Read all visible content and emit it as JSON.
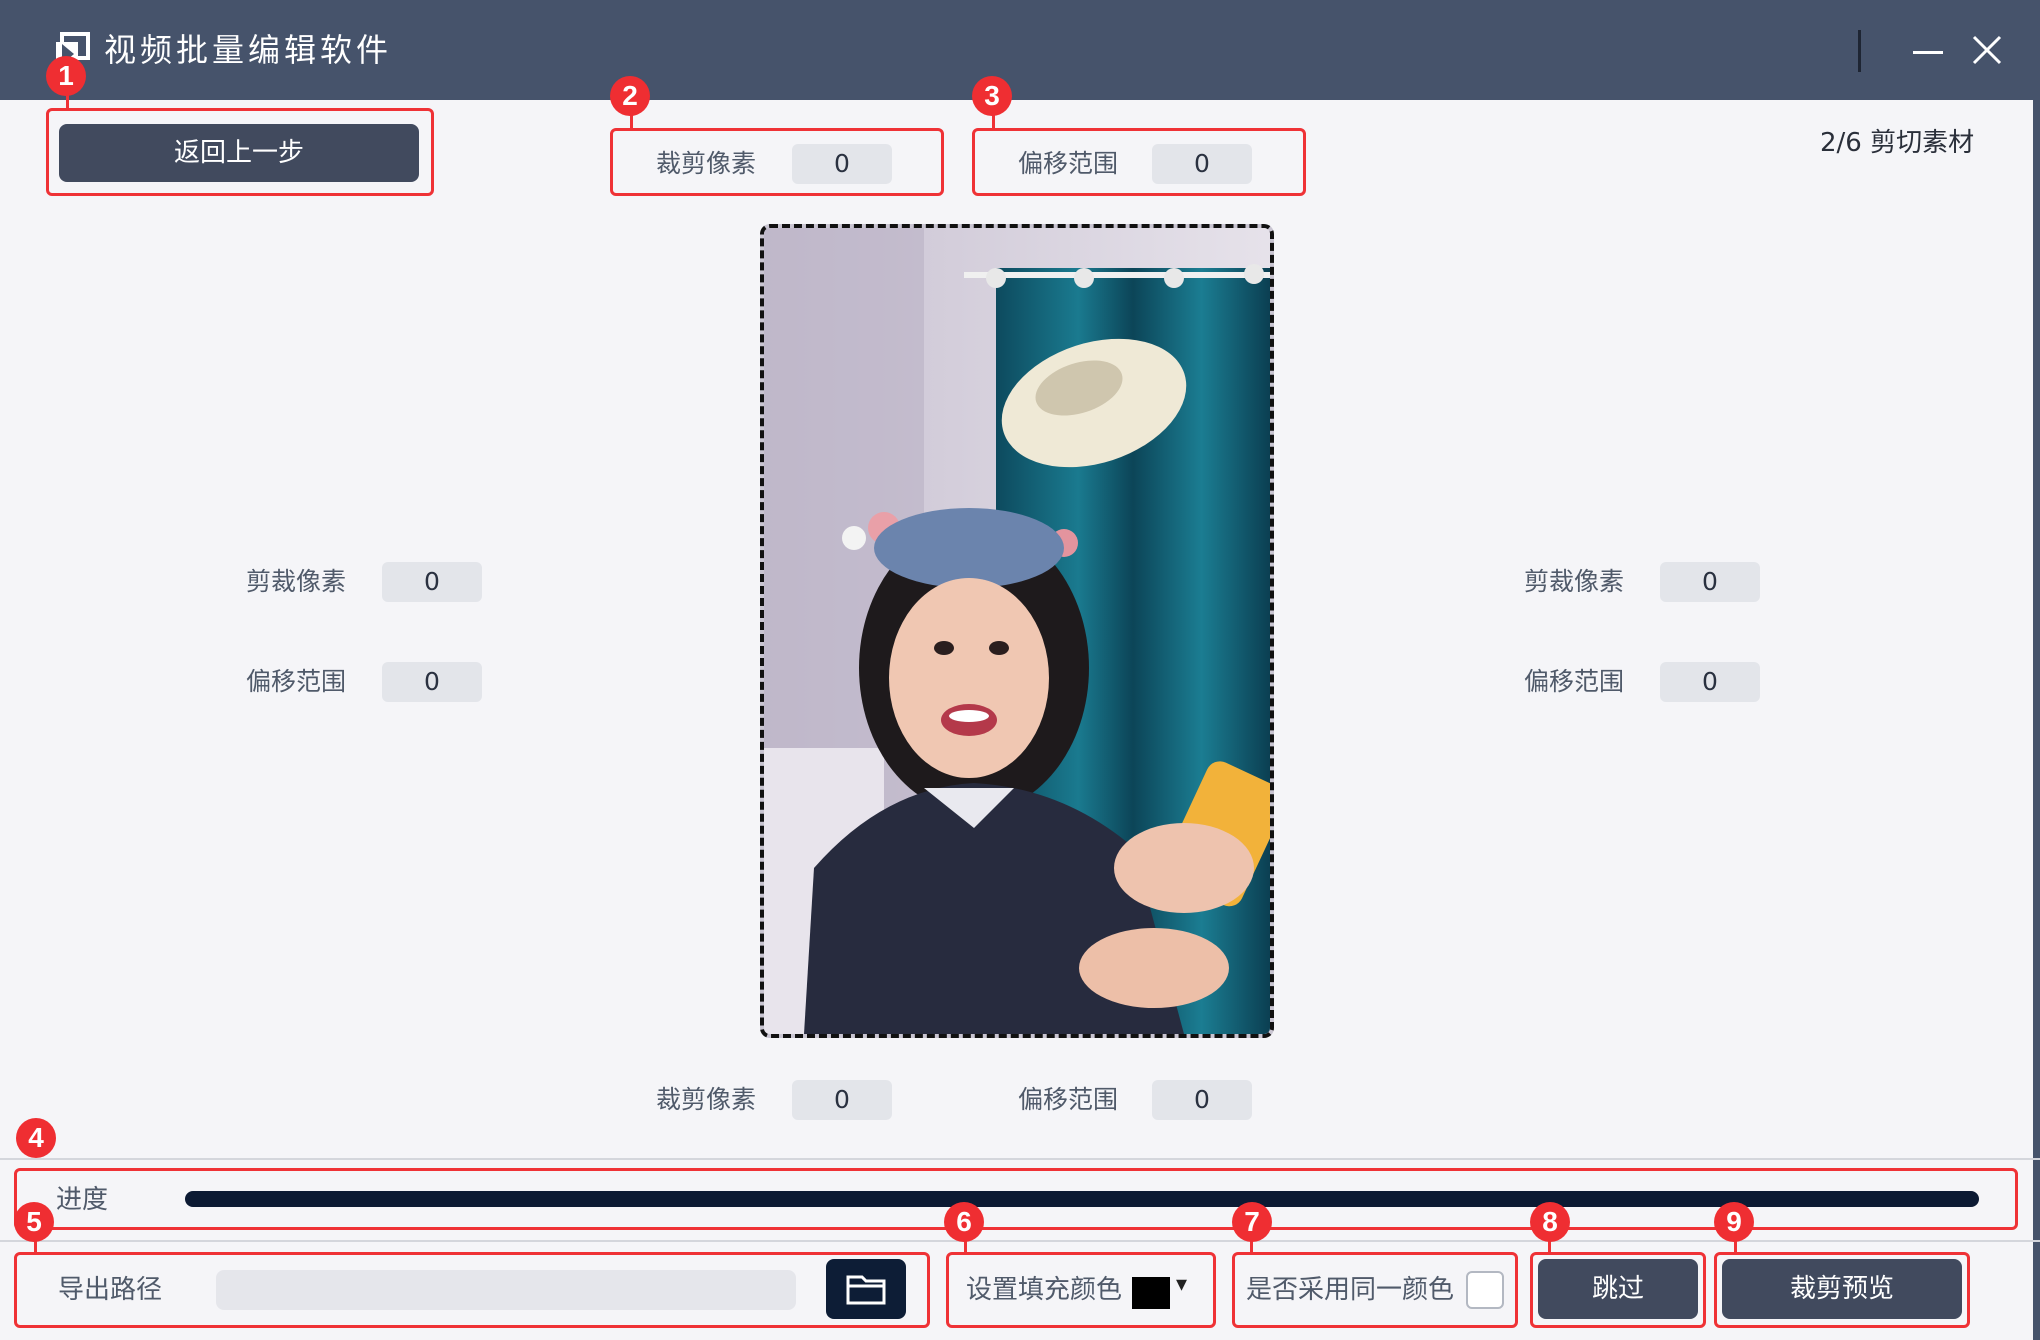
{
  "window": {
    "title": "视频批量编辑软件",
    "minimize_icon": "minimize-icon",
    "close_icon": "close-icon"
  },
  "header": {
    "back_button": "返回上一步",
    "step_indicator": "2/6 剪切素材"
  },
  "top_controls": {
    "crop_label": "裁剪像素",
    "crop_value": "0",
    "offset_label": "偏移范围",
    "offset_value": "0"
  },
  "left_controls": {
    "crop_label": "剪裁像素",
    "crop_value": "0",
    "offset_label": "偏移范围",
    "offset_value": "0"
  },
  "right_controls": {
    "crop_label": "剪裁像素",
    "crop_value": "0",
    "offset_label": "偏移范围",
    "offset_value": "0"
  },
  "bottom_controls": {
    "crop_label": "裁剪像素",
    "crop_value": "0",
    "offset_label": "偏移范围",
    "offset_value": "0"
  },
  "progress": {
    "label": "进度",
    "value": 1.0
  },
  "export": {
    "label": "导出路径",
    "value": "",
    "folder_icon": "folder-icon"
  },
  "fill_color": {
    "label": "设置填充颜色",
    "color": "#000000"
  },
  "same_color": {
    "label": "是否采用同一颜色",
    "checked": false
  },
  "actions": {
    "skip": "跳过",
    "crop_preview": "裁剪预览"
  },
  "annotations": [
    "1",
    "2",
    "3",
    "4",
    "5",
    "6",
    "7",
    "8",
    "9"
  ],
  "colors": {
    "titlebar": "#46536b",
    "accent_red": "#ef2e32",
    "button_dark": "#414a5e",
    "progress": "#0c1a33"
  }
}
